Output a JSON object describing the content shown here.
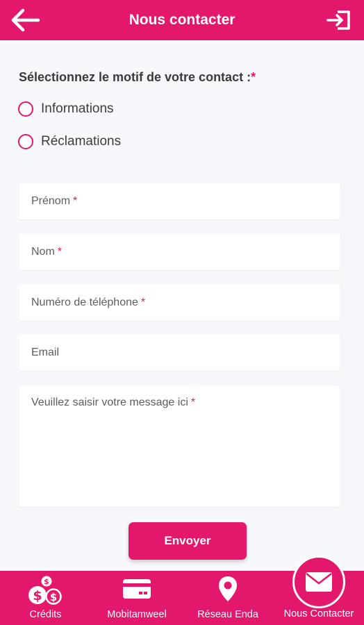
{
  "header": {
    "title": "Nous contacter",
    "back_icon": "arrow-left-icon",
    "logout_icon": "sign-out-icon"
  },
  "form": {
    "reason_label": "Sélectionnez le motif de votre contact :",
    "required_mark": "*",
    "reasons": [
      {
        "label": "Informations",
        "selected": false
      },
      {
        "label": "Réclamations",
        "selected": false
      }
    ],
    "fields": {
      "first_name": {
        "placeholder": "Prénom",
        "value": "",
        "required": "*"
      },
      "last_name": {
        "placeholder": "Nom",
        "value": "",
        "required": "*"
      },
      "phone": {
        "placeholder": "Numéro de téléphone",
        "value": "",
        "required": "*"
      },
      "email": {
        "placeholder": "Email",
        "value": ""
      },
      "message": {
        "placeholder": "Veuillez saisir votre message ici",
        "value": "",
        "required": "*"
      }
    },
    "submit_label": "Envoyer"
  },
  "bottom_nav": {
    "items": [
      {
        "label": "Crédits",
        "icon": "money-coins-icon"
      },
      {
        "label": "Mobitamweel",
        "icon": "credit-card-icon"
      },
      {
        "label": "Réseau Enda",
        "icon": "map-pin-icon"
      },
      {
        "label": "Nous Contacter",
        "icon": "envelope-icon",
        "active": true
      }
    ]
  },
  "colors": {
    "primary": "#e3176b",
    "background": "#f6f8fb",
    "white": "#ffffff"
  }
}
